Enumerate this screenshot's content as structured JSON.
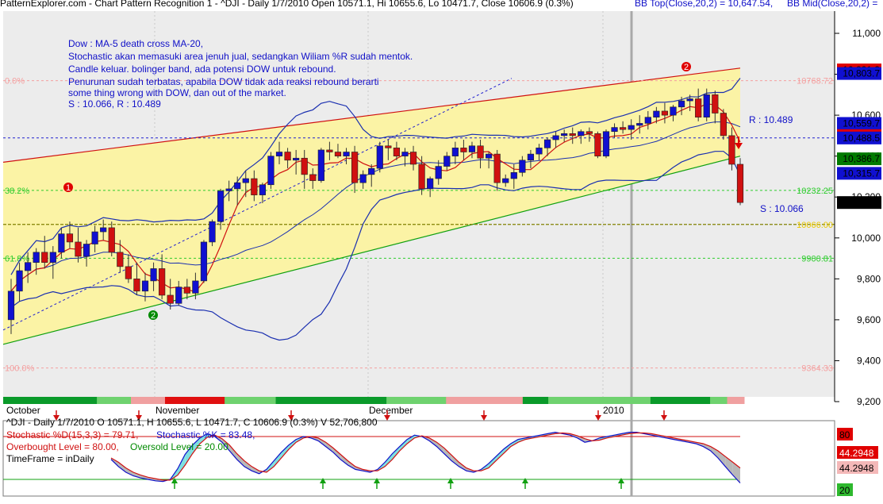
{
  "header": {
    "title": "PatternExplorer.com - Chart Pattern Recognition 1 - ^DJI - Daily 1/7/2010 Open 10571.1, Hi 10655.6, Lo 10471.7, Close 10606.9 (0.3%)",
    "bb_top": "BB Top(Close,20,2) = 10,647.54,",
    "bb_mid": "BB Mid(Close,20,2) ="
  },
  "annotation": {
    "lines": [
      "Dow : MA-5 death cross MA-20,",
      "Stochastic akan memasuki area jenuh jual, sedangkan Wiliam %R sudah mentok.",
      "Candle keluar. bolinger band, ada potensi DOW untuk rebound.",
      "Penurunan sudah terbatas, apabila DOW tidak ada reaksi rebound berarti",
      "some thing wrong with DOW, dan out of the market.",
      "S : 10.066, R : 10.489"
    ],
    "resistance_label": "R : 10.489",
    "support_label": "S : 10.066",
    "pattern_markers": [
      "1",
      "2",
      "2"
    ]
  },
  "fib_levels": [
    {
      "pct": "0.0%",
      "value": 10768.72,
      "label": "10768.72"
    },
    {
      "pct": "38.2%",
      "value": 10232.25,
      "label": "10232.25"
    },
    {
      "pct": "",
      "value": 10066.0,
      "label": "10066.00"
    },
    {
      "pct": "61.8%",
      "value": 9900.81,
      "label": "9900.81"
    },
    {
      "pct": "100.0%",
      "value": 9364.33,
      "label": "9364.33"
    }
  ],
  "price_axis": {
    "ticks": [
      "11,000",
      "10,800",
      "10,600",
      "10,400",
      "10,200",
      "10,000",
      "9,800",
      "9,600",
      "9,400",
      "9,200"
    ],
    "ylim": [
      9200,
      11100
    ],
    "badges": [
      {
        "label": "10,821.3",
        "value": 10821.3,
        "color": "#e00000"
      },
      {
        "label": "10,803.7",
        "value": 10803.7,
        "color": "#1010d0"
      },
      {
        "label": "10,559.7",
        "value": 10559.7,
        "color": "#1010d0"
      },
      {
        "label": "10,500.2",
        "value": 10500.2,
        "color": "#e00000"
      },
      {
        "label": "10,488.5",
        "value": 10488.5,
        "color": "#1010d0"
      },
      {
        "label": "10,386.7",
        "value": 10386.7,
        "color": "#007a00"
      },
      {
        "label": "10,315.7",
        "value": 10315.7,
        "color": "#1010d0"
      },
      {
        "label": "10,173",
        "value": 10173,
        "color": "#000000"
      }
    ]
  },
  "x_axis": {
    "months": [
      "October",
      "November",
      "December",
      "2010"
    ]
  },
  "chart_data": {
    "type": "candlestick",
    "symbol": "^DJI",
    "timeframe": "Daily",
    "ylim": [
      9200,
      11100
    ],
    "candles": [
      [
        9600,
        9800,
        9530,
        9740
      ],
      [
        9740,
        9880,
        9690,
        9840
      ],
      [
        9840,
        9930,
        9780,
        9880
      ],
      [
        9880,
        9950,
        9820,
        9930
      ],
      [
        9930,
        10010,
        9850,
        9880
      ],
      [
        9880,
        9960,
        9800,
        9930
      ],
      [
        9930,
        10050,
        9900,
        10020
      ],
      [
        10020,
        10080,
        9950,
        9980
      ],
      [
        9980,
        10050,
        9880,
        9910
      ],
      [
        9910,
        9990,
        9860,
        9970
      ],
      [
        9970,
        10060,
        9930,
        10030
      ],
      [
        10030,
        10090,
        9990,
        10050
      ],
      [
        10050,
        10080,
        9910,
        9930
      ],
      [
        9930,
        9990,
        9830,
        9860
      ],
      [
        9860,
        9920,
        9780,
        9800
      ],
      [
        9800,
        9880,
        9720,
        9740
      ],
      [
        9740,
        9830,
        9690,
        9790
      ],
      [
        9790,
        9880,
        9740,
        9850
      ],
      [
        9850,
        9920,
        9700,
        9720
      ],
      [
        9720,
        9800,
        9650,
        9680
      ],
      [
        9680,
        9790,
        9670,
        9760
      ],
      [
        9760,
        9800,
        9700,
        9730
      ],
      [
        9730,
        9830,
        9700,
        9790
      ],
      [
        9790,
        9990,
        9780,
        9980
      ],
      [
        9980,
        10090,
        9960,
        10080
      ],
      [
        10080,
        10240,
        10040,
        10230
      ],
      [
        10230,
        10280,
        10180,
        10240
      ],
      [
        10240,
        10300,
        10160,
        10270
      ],
      [
        10270,
        10330,
        10200,
        10290
      ],
      [
        10290,
        10330,
        10180,
        10210
      ],
      [
        10210,
        10270,
        10170,
        10260
      ],
      [
        10260,
        10420,
        10240,
        10400
      ],
      [
        10400,
        10470,
        10360,
        10420
      ],
      [
        10420,
        10440,
        10340,
        10380
      ],
      [
        10380,
        10430,
        10310,
        10390
      ],
      [
        10390,
        10430,
        10240,
        10310
      ],
      [
        10310,
        10340,
        10240,
        10280
      ],
      [
        10280,
        10440,
        10270,
        10430
      ],
      [
        10430,
        10470,
        10380,
        10420
      ],
      [
        10420,
        10460,
        10390,
        10400
      ],
      [
        10400,
        10440,
        10360,
        10420
      ],
      [
        10420,
        10450,
        10220,
        10270
      ],
      [
        10270,
        10330,
        10240,
        10310
      ],
      [
        10310,
        10360,
        10250,
        10340
      ],
      [
        10340,
        10470,
        10320,
        10450
      ],
      [
        10450,
        10480,
        10380,
        10440
      ],
      [
        10440,
        10470,
        10380,
        10400
      ],
      [
        10400,
        10440,
        10350,
        10420
      ],
      [
        10420,
        10450,
        10330,
        10360
      ],
      [
        10360,
        10400,
        10210,
        10240
      ],
      [
        10240,
        10300,
        10200,
        10290
      ],
      [
        10290,
        10380,
        10260,
        10350
      ],
      [
        10350,
        10420,
        10330,
        10400
      ],
      [
        10400,
        10470,
        10360,
        10440
      ],
      [
        10440,
        10480,
        10380,
        10420
      ],
      [
        10420,
        10470,
        10390,
        10450
      ],
      [
        10450,
        10480,
        10340,
        10390
      ],
      [
        10390,
        10420,
        10340,
        10410
      ],
      [
        10410,
        10430,
        10230,
        10270
      ],
      [
        10270,
        10310,
        10250,
        10290
      ],
      [
        10290,
        10360,
        10240,
        10320
      ],
      [
        10320,
        10400,
        10300,
        10380
      ],
      [
        10380,
        10430,
        10340,
        10410
      ],
      [
        10410,
        10460,
        10380,
        10440
      ],
      [
        10440,
        10490,
        10400,
        10480
      ],
      [
        10480,
        10520,
        10440,
        10500
      ],
      [
        10500,
        10530,
        10470,
        10510
      ],
      [
        10510,
        10540,
        10460,
        10500
      ],
      [
        10500,
        10530,
        10460,
        10520
      ],
      [
        10520,
        10540,
        10470,
        10510
      ],
      [
        10510,
        10520,
        10390,
        10400
      ],
      [
        10400,
        10530,
        10390,
        10520
      ],
      [
        10520,
        10560,
        10490,
        10540
      ],
      [
        10540,
        10570,
        10510,
        10530
      ],
      [
        10530,
        10580,
        10480,
        10550
      ],
      [
        10550,
        10600,
        10510,
        10560
      ],
      [
        10560,
        10620,
        10530,
        10590
      ],
      [
        10590,
        10640,
        10560,
        10620
      ],
      [
        10620,
        10660,
        10560,
        10600
      ],
      [
        10600,
        10650,
        10570,
        10640
      ],
      [
        10640,
        10690,
        10600,
        10670
      ],
      [
        10670,
        10700,
        10620,
        10680
      ],
      [
        10680,
        10730,
        10570,
        10590
      ],
      [
        10590,
        10730,
        10570,
        10700
      ],
      [
        10700,
        10720,
        10560,
        10610
      ],
      [
        10610,
        10630,
        10480,
        10500
      ],
      [
        10500,
        10540,
        10330,
        10360
      ],
      [
        10360,
        10390,
        10160,
        10173
      ]
    ]
  },
  "stochastic_panel": {
    "header": "^DJI - Daily 1/7/2010 O 10571.1, H 10655.6, L 10471.7, C 10606.9 (0.3%) V 52,706,800",
    "stoch_d": "Stochastic %D(15,3,3) = 79.71,",
    "stoch_k": "Stochastic %K = 83.48,",
    "overbought": "Overbought Level = 80.00,",
    "oversold": "Oversold Level = 20.00",
    "timeframe": "TimeFrame = inDaily",
    "right_badges": [
      "80",
      "44.2948",
      "44.2948",
      "20"
    ],
    "levels": {
      "overbought": 80,
      "oversold": 20
    },
    "k_values": [
      48,
      38,
      30,
      25,
      22,
      20,
      18,
      17,
      20,
      35,
      55,
      68,
      78,
      84,
      80,
      72,
      60,
      48,
      38,
      32,
      28,
      34,
      46,
      58,
      68,
      76,
      80,
      78,
      74,
      66,
      58,
      48,
      40,
      34,
      32,
      30,
      34,
      44,
      56,
      66,
      76,
      82,
      80,
      74,
      66,
      56,
      46,
      38,
      32,
      30,
      34,
      42,
      52,
      62,
      70,
      76,
      78,
      80,
      82,
      84,
      86,
      84,
      82,
      78,
      72,
      74,
      78,
      80,
      82,
      84,
      86,
      86,
      84,
      82,
      80,
      78,
      76,
      74,
      72,
      70,
      66,
      60,
      50,
      38,
      26,
      15
    ],
    "d_values": [
      50,
      44,
      36,
      30,
      26,
      23,
      21,
      19,
      19,
      26,
      40,
      56,
      70,
      79,
      82,
      77,
      68,
      56,
      46,
      38,
      32,
      30,
      38,
      50,
      62,
      72,
      78,
      80,
      78,
      72,
      64,
      55,
      46,
      38,
      34,
      32,
      32,
      38,
      48,
      60,
      70,
      78,
      81,
      78,
      72,
      64,
      54,
      44,
      36,
      32,
      32,
      36,
      46,
      56,
      66,
      72,
      76,
      78,
      80,
      82,
      84,
      85,
      84,
      81,
      77,
      74,
      75,
      78,
      80,
      82,
      84,
      85,
      85,
      84,
      82,
      80,
      78,
      76,
      74,
      72,
      70,
      66,
      60,
      52,
      44,
      36
    ]
  },
  "trend_strip": {
    "colors": [
      "#0a9a2a",
      "#0a9a2a",
      "#0a9a2a",
      "#0a9a2a",
      "#0a9a2a",
      "#0a9a2a",
      "#0a9a2a",
      "#0a9a2a",
      "#0a9a2a",
      "#0a9a2a",
      "#0a9a2a",
      "#6fd26f",
      "#6fd26f",
      "#6fd26f",
      "#6fd26f",
      "#f0a0a0",
      "#f0a0a0",
      "#f0a0a0",
      "#f0a0a0",
      "#e01010",
      "#e01010",
      "#e01010",
      "#e01010",
      "#e01010",
      "#e01010",
      "#e01010",
      "#6fd26f",
      "#6fd26f",
      "#6fd26f",
      "#6fd26f",
      "#6fd26f",
      "#6fd26f",
      "#0a9a2a",
      "#0a9a2a",
      "#0a9a2a",
      "#0a9a2a",
      "#0a9a2a",
      "#0a9a2a",
      "#0a9a2a",
      "#0a9a2a",
      "#0a9a2a",
      "#0a9a2a",
      "#0a9a2a",
      "#0a9a2a",
      "#0a9a2a",
      "#6fd26f",
      "#6fd26f",
      "#6fd26f",
      "#6fd26f",
      "#6fd26f",
      "#6fd26f",
      "#6fd26f",
      "#f0a0a0",
      "#f0a0a0",
      "#f0a0a0",
      "#f0a0a0",
      "#f0a0a0",
      "#f0a0a0",
      "#f0a0a0",
      "#f0a0a0",
      "#f0a0a0",
      "#0a9a2a",
      "#0a9a2a",
      "#0a9a2a",
      "#6fd26f",
      "#6fd26f",
      "#6fd26f",
      "#6fd26f",
      "#6fd26f",
      "#6fd26f",
      "#6fd26f",
      "#6fd26f",
      "#6fd26f",
      "#6fd26f",
      "#6fd26f",
      "#6fd26f",
      "#0a9a2a",
      "#0a9a2a",
      "#0a9a2a",
      "#0a9a2a",
      "#0a9a2a",
      "#0a9a2a",
      "#0a9a2a",
      "#6fd26f",
      "#6fd26f",
      "#f0a0a0",
      "#f0a0a0"
    ]
  },
  "colors": {
    "background": "#ececec",
    "channel_fill": "#fbf3a5",
    "bull_candle": "#1010d0",
    "bear_candle": "#d01010",
    "bollinger": "#1a2fb0",
    "ma": "#d01010",
    "channel_top": "#d01010",
    "channel_bottom": "#10a010",
    "resistance": "#2020d0",
    "support": "#808000"
  }
}
